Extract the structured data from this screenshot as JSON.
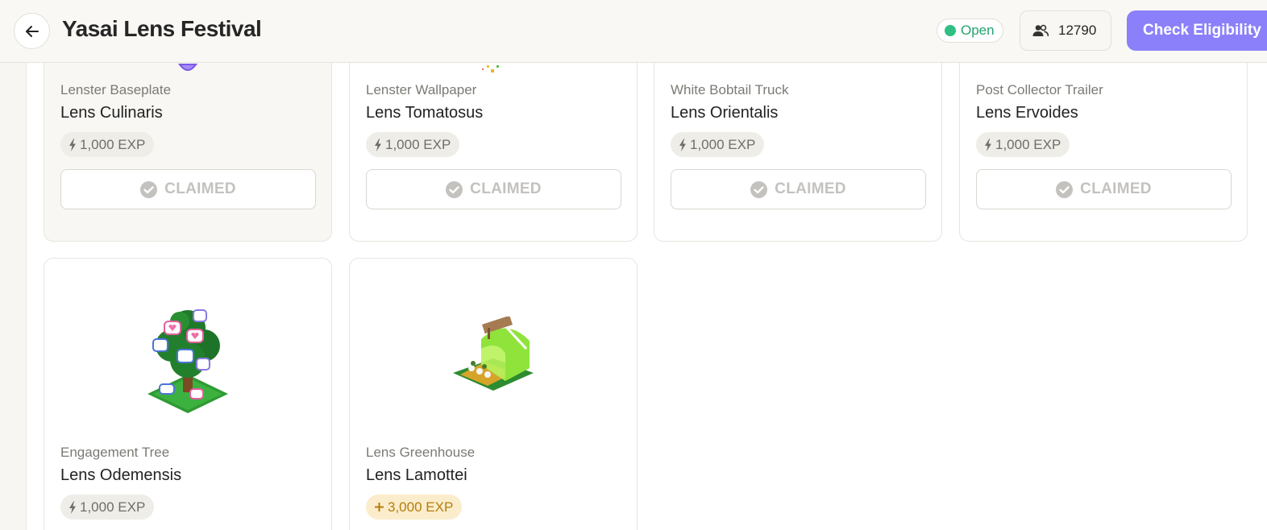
{
  "header": {
    "title": "Yasai Lens Festival",
    "status": "Open",
    "participants": "12790",
    "cta": "Check Eligibility"
  },
  "cards": [
    {
      "category": "Lenster Baseplate",
      "name": "Lens Culinaris",
      "exp": "1,000 EXP",
      "button": "CLAIMED"
    },
    {
      "category": "Lenster Wallpaper",
      "name": "Lens Tomatosus",
      "exp": "1,000 EXP",
      "button": "CLAIMED"
    },
    {
      "category": "White Bobtail Truck",
      "name": "Lens Orientalis",
      "exp": "1,000 EXP",
      "button": "CLAIMED"
    },
    {
      "category": "Post Collector Trailer",
      "name": "Lens Ervoides",
      "exp": "1,000 EXP",
      "button": "CLAIMED"
    },
    {
      "category": "Engagement Tree",
      "name": "Lens Odemensis",
      "exp": "1,000 EXP"
    },
    {
      "category": "Lens Greenhouse",
      "name": "Lens Lamottei",
      "exp": "3,000 EXP"
    }
  ],
  "colors": {
    "accent": "#8b80f9",
    "status_green": "#2fbf83",
    "bonus_gold": "#b37e0c"
  },
  "icons": {
    "back": "arrow-left-icon",
    "participants": "users-icon",
    "exp": "lightning-icon",
    "bonus": "plus-icon",
    "claimed": "check-circle-icon"
  }
}
